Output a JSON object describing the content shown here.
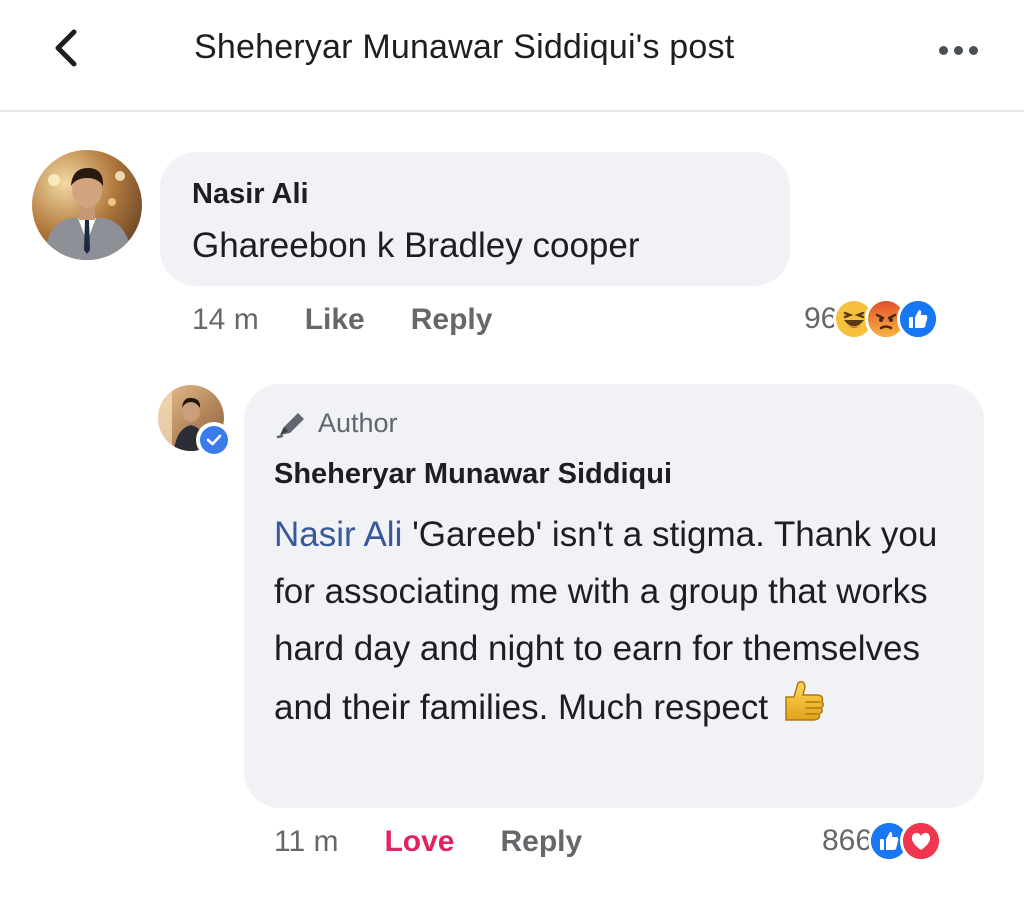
{
  "header": {
    "title": "Sheheryar Munawar Siddiqui's post",
    "back_icon": "chevron-left-icon",
    "more_icon": "more-horizontal-icon"
  },
  "comment": {
    "author": "Nasir Ali",
    "text": "Ghareebon k Bradley cooper",
    "timestamp": "14 m",
    "like_label": "Like",
    "reply_label": "Reply",
    "reaction_count": "96",
    "reactions": [
      "haha",
      "angry",
      "like"
    ]
  },
  "reply": {
    "badge_label": "Author",
    "badge_icon": "pen-icon",
    "author": "Sheheryar Munawar Siddiqui",
    "mention": "Nasir Ali",
    "text": " 'Gareeb' isn't a stigma. Thank you for associating me with a group that works hard day and night to earn for themselves and their families. Much respect",
    "emoji": "thumbs-up-emoji",
    "timestamp": "11 m",
    "love_label": "Love",
    "reply_label": "Reply",
    "reaction_count": "866",
    "reactions": [
      "like",
      "love"
    ],
    "verified": true
  },
  "colors": {
    "bubble": "#f0f2f5",
    "mention": "#385898",
    "love": "#e0245e",
    "like_blue": "#1877f2",
    "muted": "#65676b"
  }
}
